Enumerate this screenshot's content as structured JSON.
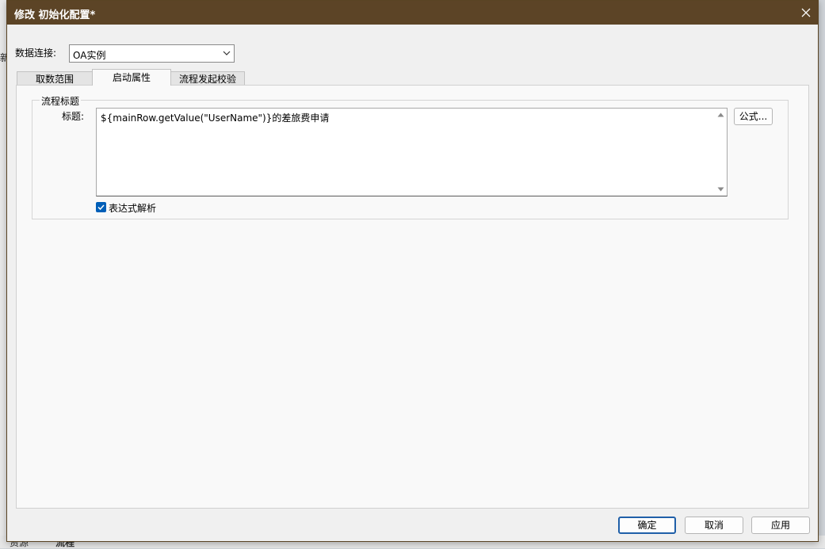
{
  "background": {
    "left_glyph": "新",
    "bottom_tab_1": "资源",
    "bottom_tab_2": "流程"
  },
  "dialog": {
    "title": "修改 初始化配置*",
    "data_connection": {
      "label": "数据连接:",
      "selected": "OA实例"
    },
    "tabs": [
      {
        "label": "取数范围",
        "active": false
      },
      {
        "label": "启动属性",
        "active": true
      },
      {
        "label": "流程发起校验",
        "active": false
      }
    ],
    "group": {
      "legend": "流程标题",
      "title_label": "标题:",
      "title_value": "${mainRow.getValue(\"UserName\")}的差旅费申请",
      "formula_button": "公式...",
      "expression_parse": {
        "label": "表达式解析",
        "checked": true
      }
    },
    "buttons": {
      "ok": "确定",
      "cancel": "取消",
      "apply": "应用"
    }
  },
  "colors": {
    "titlebar": "#5c4426",
    "accent": "#005fb8"
  }
}
